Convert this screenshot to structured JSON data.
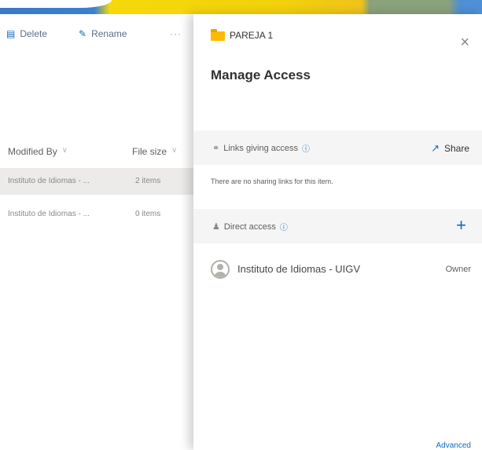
{
  "commands": {
    "delete_label": "Delete",
    "rename_label": "Rename",
    "more_label": "···"
  },
  "list": {
    "columns": [
      "Modified By",
      "File size"
    ],
    "rows": [
      {
        "modified_by": "Instituto de Idiomas - ...",
        "file_size": "2 items"
      },
      {
        "modified_by": "Instituto de Idiomas - ...",
        "file_size": "0 items"
      }
    ]
  },
  "panel": {
    "folder_name": "PAREJA 1",
    "close_icon": "×",
    "title": "Manage Access",
    "links_section": {
      "label": "Links giving access",
      "share_label": "Share",
      "empty_text": "There are no sharing links for this item."
    },
    "direct_section": {
      "label": "Direct access",
      "add_icon": "+"
    },
    "members": [
      {
        "name": "Instituto de Idiomas - UIGV",
        "role": "Owner"
      }
    ],
    "advanced_label": "Advanced"
  },
  "colors": {
    "accent": "#0f6cbd",
    "folder": "#ffb900",
    "section_bg": "#f5f5f5"
  }
}
